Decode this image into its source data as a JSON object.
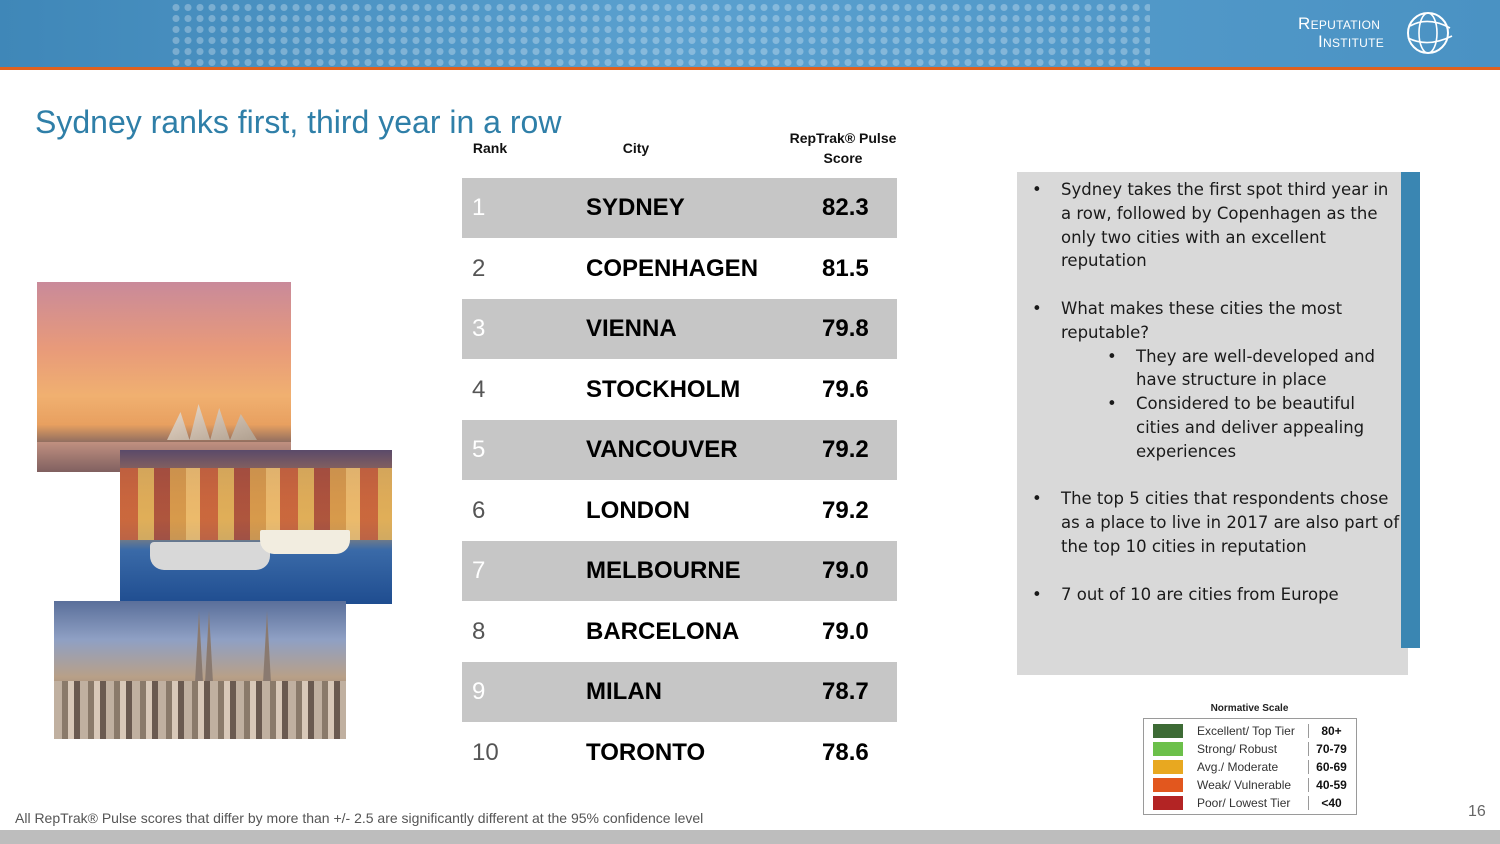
{
  "header": {
    "logo_line1": "Reputation",
    "logo_line2": "Institute"
  },
  "title": "Sydney ranks first, third year in a row",
  "table": {
    "headers": {
      "rank": "Rank",
      "city": "City",
      "score": "RepTrak® Pulse Score"
    },
    "rows": [
      {
        "rank": "1",
        "city": "SYDNEY",
        "score": "82.3"
      },
      {
        "rank": "2",
        "city": "COPENHAGEN",
        "score": "81.5"
      },
      {
        "rank": "3",
        "city": "VIENNA",
        "score": "79.8"
      },
      {
        "rank": "4",
        "city": "STOCKHOLM",
        "score": "79.6"
      },
      {
        "rank": "5",
        "city": "VANCOUVER",
        "score": "79.2"
      },
      {
        "rank": "6",
        "city": "LONDON",
        "score": "79.2"
      },
      {
        "rank": "7",
        "city": "MELBOURNE",
        "score": "79.0"
      },
      {
        "rank": "8",
        "city": "BARCELONA",
        "score": "79.0"
      },
      {
        "rank": "9",
        "city": "MILAN",
        "score": "78.7"
      },
      {
        "rank": "10",
        "city": "TORONTO",
        "score": "78.6"
      }
    ]
  },
  "bullets": {
    "b1": "Sydney takes the first spot third year in a row, followed by Copenhagen as the only two cities with an excellent reputation",
    "b2": "What makes these cities the most reputable?",
    "b2_sub1": "They are well-developed and have structure in place",
    "b2_sub2": "Considered to be beautiful cities and deliver appealing experiences",
    "b3": "The top 5 cities that respondents chose as a place to live in 2017 are also part of the top 10 cities in reputation",
    "b4": "7 out of 10 are cities from Europe"
  },
  "scale": {
    "title": "Normative Scale",
    "items": [
      {
        "label": "Excellent/ Top Tier",
        "range": "80+",
        "color": "#3d6b35"
      },
      {
        "label": "Strong/ Robust",
        "range": "70-79",
        "color": "#6cc04a"
      },
      {
        "label": "Avg./ Moderate",
        "range": "60-69",
        "color": "#e8a820"
      },
      {
        "label": "Weak/ Vulnerable",
        "range": "40-59",
        "color": "#e2571e"
      },
      {
        "label": "Poor/ Lowest Tier",
        "range": "<40",
        "color": "#b32424"
      }
    ]
  },
  "footnote": "All RepTrak® Pulse scores that differ by more than +/- 2.5 are significantly different at the 95% confidence level",
  "page_number": "16"
}
